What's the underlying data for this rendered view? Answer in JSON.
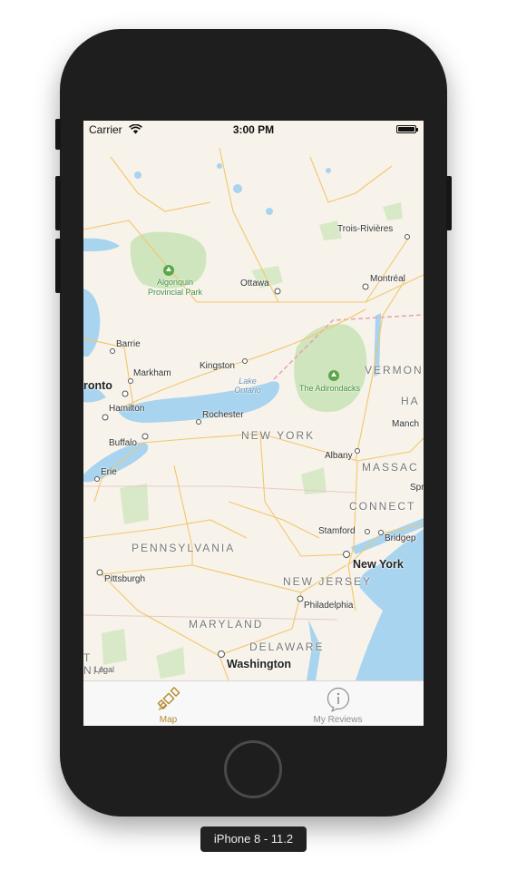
{
  "status_bar": {
    "carrier": "Carrier",
    "time": "3:00 PM",
    "icons": [
      "wifi-icon",
      "battery-icon"
    ]
  },
  "map": {
    "colors": {
      "land": "#f7f3ea",
      "water": "#a8d4ef",
      "park": "#cfe5bd",
      "road": "#f3c66a",
      "border": "#e8a0b4"
    },
    "cities": {
      "trois_rivieres": "Trois-Rivières",
      "montreal": "Montréal",
      "ottawa": "Ottawa",
      "barrie": "Barrie",
      "kingston": "Kingston",
      "markham": "Markham",
      "toronto": "ronto",
      "hamilton": "Hamilton",
      "rochester": "Rochester",
      "buffalo": "Buffalo",
      "albany": "Albany",
      "erie": "Erie",
      "stamford": "Stamford",
      "bridgeport": "Bridgep",
      "new_york": "New York",
      "pittsburgh": "Pittsburgh",
      "philadelphia": "Philadelphia",
      "washington": "Washington",
      "manchester": "Manch",
      "springfield": "Spr"
    },
    "states": {
      "new_york": "NEW YORK",
      "vermont": "VERMON",
      "massachusetts": "MASSAC",
      "connecticut": "CONNECT",
      "new_hampshire": "HA",
      "pennsylvania": "PENNSYLVANIA",
      "new_jersey": "NEW JERSEY",
      "maryland": "MARYLAND",
      "delaware": "DELAWARE",
      "west_virginia_a": "T",
      "west_virginia_b": "NIA"
    },
    "parks": {
      "algonquin_line1": "Algonquin",
      "algonquin_line2": "Provincial Park",
      "adirondacks": "The Adirondacks"
    },
    "water": {
      "lake_ontario_line1": "Lake",
      "lake_ontario_line2": "Ontario"
    },
    "legal": "Legal"
  },
  "tab_bar": {
    "accent_color": "#b58a2e",
    "inactive_color": "#8e8e93",
    "tabs": [
      {
        "label": "Map",
        "icon": "satellite-icon",
        "selected": true
      },
      {
        "label": "My Reviews",
        "icon": "info-icon",
        "selected": false
      }
    ]
  },
  "device": {
    "label": "iPhone 8 - 11.2"
  }
}
